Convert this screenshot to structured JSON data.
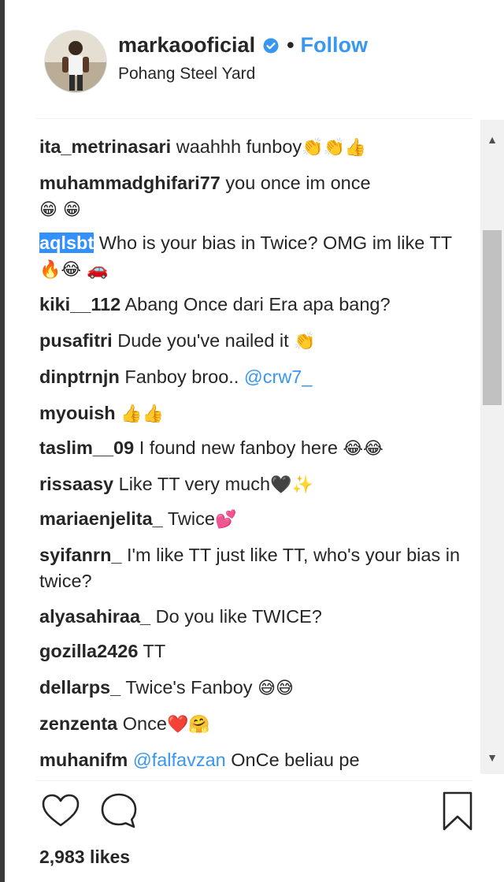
{
  "header": {
    "username": "markaooficial",
    "separator": "•",
    "follow_label": "Follow",
    "location": "Pohang Steel Yard"
  },
  "comments": [
    {
      "user": "ita_metrinasari",
      "text": "waahhh funboy",
      "emoji": "👏👏👍"
    },
    {
      "user": "muhammadghifari77",
      "text": "you once im once",
      "emoji": "😁 😁"
    },
    {
      "user": "aqlsbt",
      "text": "Who is your bias in Twice? OMG im like TT",
      "emoji": "🔥😂 🚗"
    },
    {
      "user": "kiki__112",
      "text": "Abang Once dari Era apa bang?"
    },
    {
      "user": "pusafitri",
      "text": "Dude you've nailed it",
      "emoji": "👏"
    },
    {
      "user": "dinptrnjn",
      "text": "Fanboy broo..",
      "mention": "@crw7_"
    },
    {
      "user": "myouish",
      "text": "",
      "emoji": "👍👍"
    },
    {
      "user": "taslim__09",
      "text": "I found new fanboy here",
      "emoji": "😂😂"
    },
    {
      "user": "rissaasy",
      "text": "Like TT very much",
      "emoji": "🖤✨"
    },
    {
      "user": "mariaenjelita_",
      "text": "Twice",
      "emoji": "💕"
    },
    {
      "user": "syifanrn_",
      "text": "I'm like TT just like TT, who's your bias in twice?"
    },
    {
      "user": "alyasahiraa_",
      "text": "Do you like TWICE?"
    },
    {
      "user": "gozilla2426",
      "text": "TT"
    },
    {
      "user": "dellarps_",
      "text": "Twice's Fanboy",
      "emoji": "😅😅"
    },
    {
      "user": "zenzenta",
      "text": "Once",
      "emoji": "❤️🤗"
    },
    {
      "user": "muhanifm",
      "mention": "@falfavzan",
      "text_after": "OnCe beliau pe"
    }
  ],
  "footer": {
    "likes_text": "2,983 likes"
  },
  "icons": {
    "like": "heart-icon",
    "comment": "comment-bubble-icon",
    "save": "bookmark-icon",
    "verified": "verified-badge-icon",
    "scroll_up": "scroll-up-arrow-icon",
    "scroll_down": "scroll-down-arrow-icon"
  },
  "colors": {
    "link": "#3897f0",
    "text": "#262626",
    "selection": "#3390ff"
  }
}
